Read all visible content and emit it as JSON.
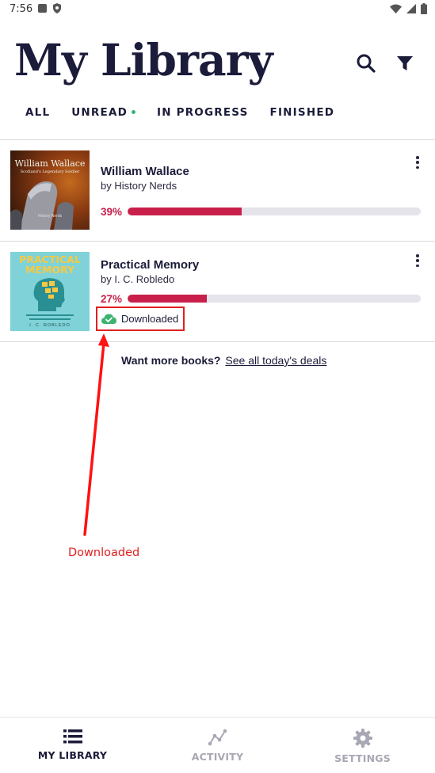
{
  "status_bar": {
    "time": "7:56"
  },
  "header": {
    "title": "My Library"
  },
  "tabs": [
    {
      "label": "ALL"
    },
    {
      "label": "UNREAD"
    },
    {
      "label": "IN PROGRESS"
    },
    {
      "label": "FINISHED"
    }
  ],
  "books": [
    {
      "title": "William Wallace",
      "author": "by History Nerds",
      "progress_text": "39%",
      "progress": 0.39,
      "cover_title": "William Wallace",
      "cover_subtitle": "Scotland's Legendary Soldier",
      "cover_author": "History Nerds"
    },
    {
      "title": "Practical Memory",
      "author": "by I. C. Robledo",
      "progress_text": "27%",
      "progress": 0.27,
      "status": "Downloaded",
      "cover_title": "PRACTICAL MEMORY",
      "cover_author": "I. C. ROBLEDO"
    }
  ],
  "deals": {
    "prompt": "Want more books?",
    "link": "See all today's deals"
  },
  "annotation": {
    "label": "Downloaded"
  },
  "bottom_nav": [
    {
      "label": "MY LIBRARY",
      "icon": "list-icon",
      "active": true
    },
    {
      "label": "ACTIVITY",
      "icon": "activity-icon",
      "active": false
    },
    {
      "label": "SETTINGS",
      "icon": "gear-icon",
      "active": false
    }
  ],
  "colors": {
    "accent": "#c8204a",
    "primary": "#1b1b3a",
    "success": "#3cb371",
    "annotation": "#e02020"
  }
}
